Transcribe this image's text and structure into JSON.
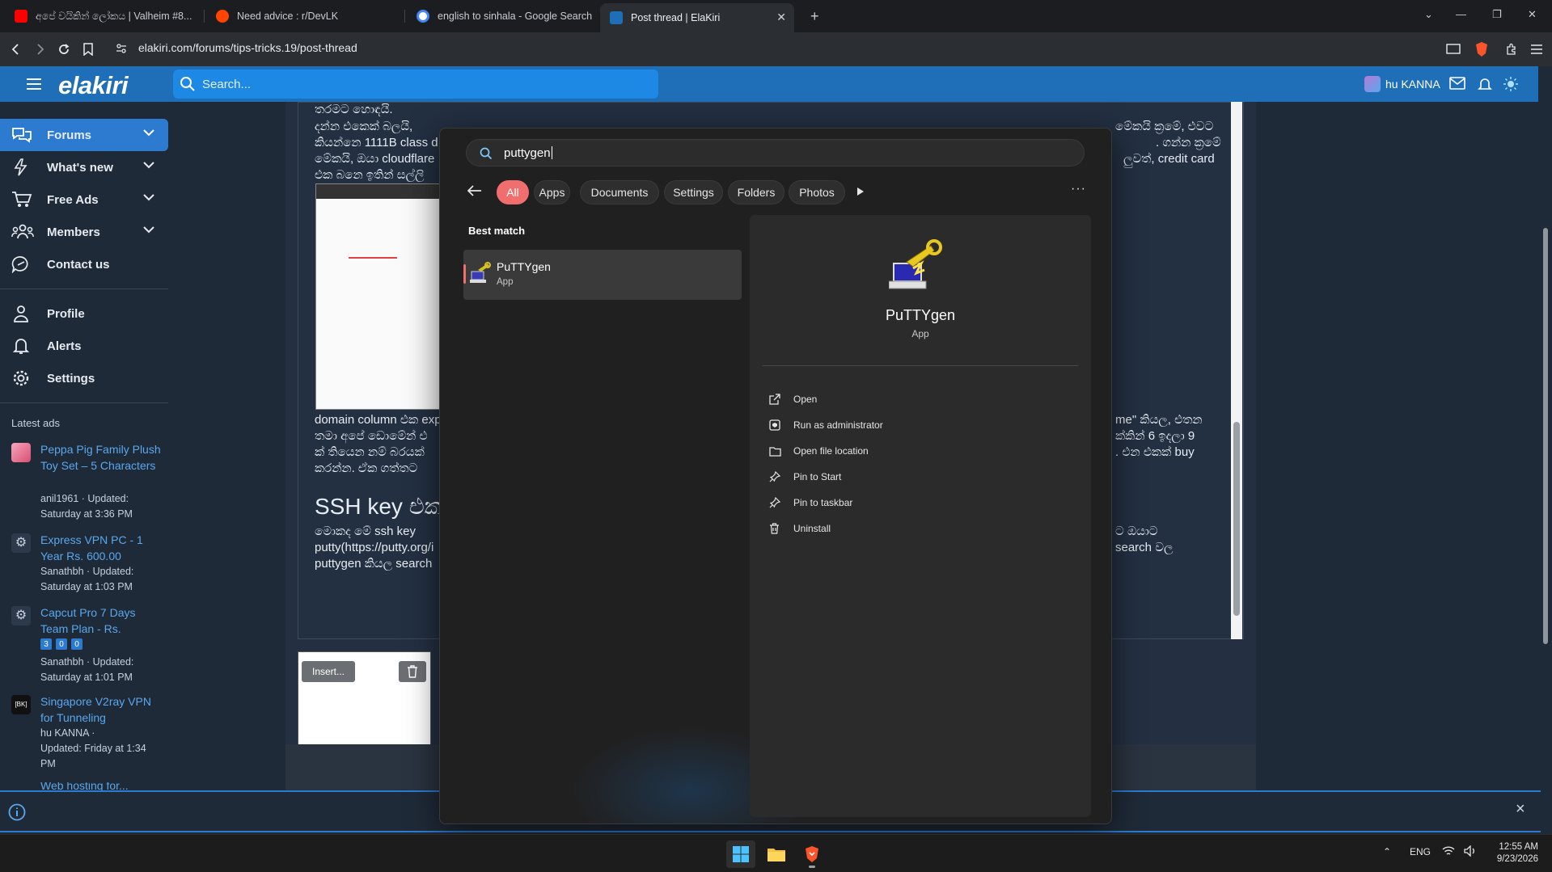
{
  "browser": {
    "tabs": [
      {
        "title": "අපේ වයිකින් ලෝකය | Valheim #8...",
        "favicon_color": "#ff0000"
      },
      {
        "title": "Need advice : r/DevLK",
        "favicon_color": "#ff4500"
      },
      {
        "title": "english to sinhala - Google Search",
        "favicon_color": "#4285f4"
      },
      {
        "title": "Post thread | ElaKiri",
        "favicon_color": "#1f6fb8"
      }
    ],
    "new_tab": "+",
    "url": "elakiri.com/forums/tips-tricks.19/post-thread"
  },
  "site": {
    "logo": "elakiri",
    "search_placeholder": "Search...",
    "username": "hu KANNA"
  },
  "sidebar": {
    "nav": [
      {
        "label": "Forums",
        "icon": "forums-icon",
        "expandable": true,
        "active": true
      },
      {
        "label": "What's new",
        "icon": "lightning-icon",
        "expandable": true
      },
      {
        "label": "Free Ads",
        "icon": "cart-icon",
        "expandable": true
      },
      {
        "label": "Members",
        "icon": "members-icon",
        "expandable": true
      },
      {
        "label": "Contact us",
        "icon": "chat-icon",
        "expandable": false
      }
    ],
    "account": [
      {
        "label": "Profile",
        "icon": "user-icon"
      },
      {
        "label": "Alerts",
        "icon": "bell-icon"
      },
      {
        "label": "Settings",
        "icon": "gear-icon"
      }
    ],
    "latest_ads_heading": "Latest ads",
    "ads": [
      {
        "title": "Peppa Pig Family Plush Toy Set – 5 Characters",
        "author": "anil1961",
        "updated": "Updated:",
        "when": "Saturday at 3:36 PM"
      },
      {
        "title": "Express VPN PC - 1 Year Rs. 600.00",
        "author": "Sanathbh",
        "updated": "Updated:",
        "when": "Saturday at 1:03 PM"
      },
      {
        "title": "Capcut Pro 7 Days Team Plan - Rs.",
        "badges": [
          "3",
          "0",
          "0"
        ],
        "author": "Sanathbh",
        "updated": "Updated:",
        "when": "Saturday at 1:01 PM"
      },
      {
        "title": "Singapore V2ray VPN for Tunneling",
        "author": "hu KANNA",
        "updated": "Updated:",
        "when": "Friday at 1:34 PM"
      },
      {
        "title": "Web hosting for..."
      }
    ]
  },
  "editor": {
    "line1": "තරමට හොඳයි.",
    "line2_left": "දන්න එකෙක් බලයි, ",
    "line2_right": "මේකයි ක්‍රමේ, එවට",
    "line3_left": "කියන්නෙ 1111B class d",
    "line3_right": ". ගන්න ක්‍රමේ",
    "line4_left": "මේකයි, ඔයා cloudflare",
    "line4_right": "ලුවත්, credit card",
    "line5_left": "එක බනෙ ඉතින් සල්ලි",
    "para2_l1": "domain column එක exp",
    "para2_r1": "me\" කියල, එතන",
    "para2_l2": "තමා අපේ ඩොමේන් එ",
    "para2_r2": "ක්කින් 6 ඉදලා 9",
    "para2_l3": "ක් තියෙන නම් බරයක්",
    "para2_r3": ". එන එකක් buy",
    "para2_l4": "කරන්න. ඒක ගත්තට ",
    "heading": "SSH key එකෑ",
    "para3_l1": "මොකද මේ ssh key ",
    "para3_r1": "ට ඔයාට",
    "para3_l2": "putty(https://putty.org/i",
    "para3_r2": "search වල",
    "para3_l3": "puttygen කියල search ",
    "attach_insert": "Insert...",
    "notice_close": "×"
  },
  "start": {
    "query": "puttygen",
    "filters": [
      "All",
      "Apps",
      "Documents",
      "Settings",
      "Folders",
      "Photos"
    ],
    "selected_filter": "All",
    "more": "···",
    "best_match_heading": "Best match",
    "result": {
      "name": "PuTTYgen",
      "type": "App"
    },
    "actions": [
      {
        "label": "Open",
        "icon": "open-external-icon"
      },
      {
        "label": "Run as administrator",
        "icon": "shield-admin-icon"
      },
      {
        "label": "Open file location",
        "icon": "folder-icon"
      },
      {
        "label": "Pin to Start",
        "icon": "pin-icon"
      },
      {
        "label": "Pin to taskbar",
        "icon": "pin-icon"
      },
      {
        "label": "Uninstall",
        "icon": "trash-icon"
      }
    ],
    "accent": "#f06e6e"
  },
  "taskbar": {
    "lang": "ENG",
    "time": "12:55 AM",
    "date": "9/23/2026"
  }
}
